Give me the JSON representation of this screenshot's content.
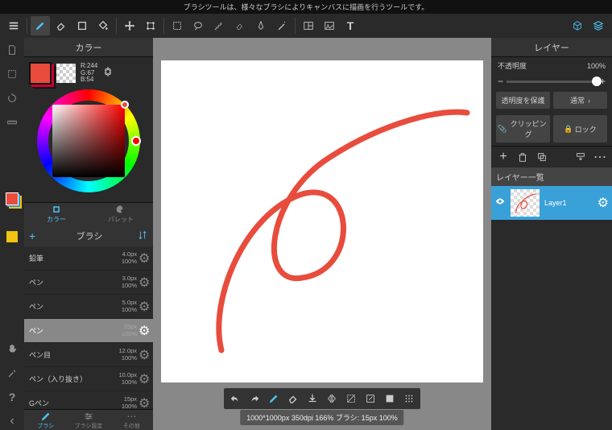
{
  "topmsg": "ブラシツールは、様々なブラシによりキャンバスに描画を行うツールです。",
  "color": {
    "title": "カラー",
    "rgb": {
      "r": "R:244",
      "g": "G:67",
      "b": "B:54"
    },
    "tabs": {
      "color": "カラー",
      "palette": "パレット"
    }
  },
  "brush": {
    "title": "ブラシ",
    "items": [
      {
        "name": "鉛筆",
        "size": "4.0px",
        "op": "100%"
      },
      {
        "name": "ペン",
        "size": "3.0px",
        "op": "100%"
      },
      {
        "name": "ペン",
        "size": "5.0px",
        "op": "100%"
      },
      {
        "name": "ペン",
        "size": "15px",
        "op": "100%"
      },
      {
        "name": "ペン目",
        "size": "12.0px",
        "op": "100%"
      },
      {
        "name": "ペン（入り抜き）",
        "size": "10.0px",
        "op": "100%"
      },
      {
        "name": "Gペン",
        "size": "15px",
        "op": "100%"
      }
    ],
    "tabs": {
      "brush": "ブラシ",
      "settings": "ブラシ設定",
      "other": "その他"
    }
  },
  "layer": {
    "title": "レイヤー",
    "opacity_label": "不透明度",
    "opacity_value": "100%",
    "protect_alpha": "透明度を保護",
    "blend": "通常",
    "clipping": "クリッピング",
    "lock": "ロック",
    "list_title": "レイヤー一覧",
    "layer1": "Layer1"
  },
  "status": "1000*1000px 350dpi 166% ブラシ: 15px 100%"
}
